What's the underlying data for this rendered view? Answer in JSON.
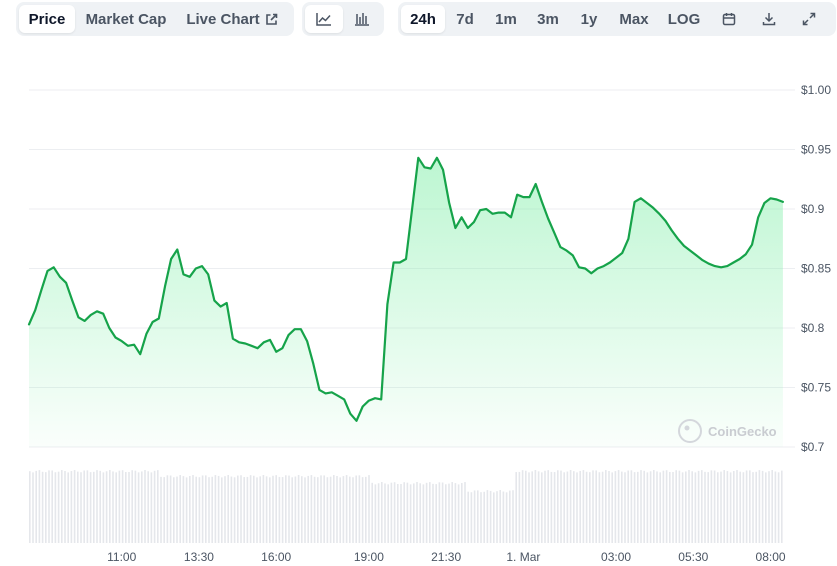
{
  "toolbar": {
    "metric_tabs": [
      {
        "label": "Price",
        "active": true
      },
      {
        "label": "Market Cap",
        "active": false
      },
      {
        "label": "Live Chart",
        "active": false
      }
    ],
    "chart_type_icons": [
      "line-chart-icon",
      "candlestick-chart-icon"
    ],
    "range_tabs": [
      {
        "label": "24h",
        "active": true
      },
      {
        "label": "7d",
        "active": false
      },
      {
        "label": "1m",
        "active": false
      },
      {
        "label": "3m",
        "active": false
      },
      {
        "label": "1y",
        "active": false
      },
      {
        "label": "Max",
        "active": false
      },
      {
        "label": "LOG",
        "active": false
      }
    ],
    "tool_icons": [
      "calendar-icon",
      "download-icon",
      "expand-icon"
    ]
  },
  "watermark": "CoinGecko",
  "colors": {
    "line": "#16a34a",
    "fill_top": "#86efac",
    "grid": "#eceef1",
    "volume": "#e5e7eb",
    "axis_text": "#4b5563",
    "tab_bg": "#eff2f5"
  },
  "chart_data": {
    "type": "area",
    "title": "",
    "xlabel": "",
    "ylabel": "",
    "y_ticks": [
      "$1.00",
      "$0.95",
      "$0.9",
      "$0.85",
      "$0.8",
      "$0.75",
      "$0.7"
    ],
    "y_tick_values": [
      1.0,
      0.95,
      0.9,
      0.85,
      0.8,
      0.75,
      0.7
    ],
    "x_ticks": [
      "11:00",
      "13:30",
      "16:00",
      "19:00",
      "21:30",
      "1. Mar",
      "03:00",
      "05:30",
      "08:00"
    ],
    "x_tick_hours": [
      11.0,
      13.5,
      16.0,
      19.0,
      21.5,
      24.0,
      27.0,
      29.5,
      32.0
    ],
    "x_range_hours": [
      8.0,
      32.5
    ],
    "ylim": [
      0.7,
      1.0
    ],
    "grid": true,
    "volume_bars": true,
    "series": [
      {
        "x_hours": [
          8.0,
          8.2,
          8.4,
          8.6,
          8.8,
          9.0,
          9.2,
          9.4,
          9.6,
          9.8,
          10.0,
          10.2,
          10.4,
          10.6,
          10.8,
          11.0,
          11.2,
          11.4,
          11.6,
          11.8,
          12.0,
          12.2,
          12.4,
          12.6,
          12.8,
          13.0,
          13.2,
          13.4,
          13.6,
          13.8,
          14.0,
          14.2,
          14.4,
          14.6,
          14.8,
          15.0,
          15.2,
          15.4,
          15.6,
          15.8,
          16.0,
          16.2,
          16.4,
          16.6,
          16.8,
          17.0,
          17.2,
          17.4,
          17.6,
          17.8,
          18.0,
          18.2,
          18.4,
          18.6,
          18.8,
          19.0,
          19.2,
          19.4,
          19.6,
          19.8,
          20.0,
          20.2,
          20.4,
          20.6,
          20.8,
          21.0,
          21.2,
          21.4,
          21.6,
          21.8,
          22.0,
          22.2,
          22.4,
          22.6,
          22.8,
          23.0,
          23.2,
          23.4,
          23.6,
          23.8,
          24.0,
          24.2,
          24.4,
          24.6,
          24.8,
          25.0,
          25.2,
          25.4,
          25.6,
          25.8,
          26.0,
          26.2,
          26.4,
          26.6,
          26.8,
          27.0,
          27.2,
          27.4,
          27.6,
          27.8,
          28.0,
          28.2,
          28.4,
          28.6,
          28.8,
          29.0,
          29.2,
          29.4,
          29.6,
          29.8,
          30.0,
          30.2,
          30.4,
          30.6,
          30.8,
          31.0,
          31.2,
          31.4,
          31.6,
          31.8,
          32.0,
          32.2,
          32.4
        ],
        "values": [
          0.803,
          0.815,
          0.832,
          0.848,
          0.851,
          0.843,
          0.838,
          0.823,
          0.809,
          0.806,
          0.811,
          0.814,
          0.812,
          0.8,
          0.792,
          0.789,
          0.785,
          0.786,
          0.778,
          0.795,
          0.805,
          0.808,
          0.835,
          0.858,
          0.866,
          0.845,
          0.843,
          0.85,
          0.852,
          0.845,
          0.823,
          0.818,
          0.821,
          0.791,
          0.788,
          0.787,
          0.785,
          0.783,
          0.788,
          0.79,
          0.78,
          0.783,
          0.794,
          0.799,
          0.799,
          0.789,
          0.77,
          0.748,
          0.745,
          0.746,
          0.743,
          0.74,
          0.728,
          0.722,
          0.734,
          0.739,
          0.741,
          0.74,
          0.82,
          0.855,
          0.855,
          0.858,
          0.9,
          0.943,
          0.935,
          0.934,
          0.943,
          0.933,
          0.905,
          0.884,
          0.893,
          0.884,
          0.889,
          0.899,
          0.9,
          0.896,
          0.897,
          0.897,
          0.893,
          0.912,
          0.91,
          0.91,
          0.921,
          0.906,
          0.892,
          0.88,
          0.868,
          0.865,
          0.861,
          0.851,
          0.85,
          0.846,
          0.85,
          0.852,
          0.855,
          0.859,
          0.863,
          0.875,
          0.906,
          0.909,
          0.905,
          0.901,
          0.896,
          0.89,
          0.882,
          0.875,
          0.869,
          0.865,
          0.861,
          0.857,
          0.854,
          0.852,
          0.851,
          0.852,
          0.855,
          0.858,
          0.862,
          0.87,
          0.893,
          0.905,
          0.909,
          0.908,
          0.906
        ]
      }
    ]
  }
}
